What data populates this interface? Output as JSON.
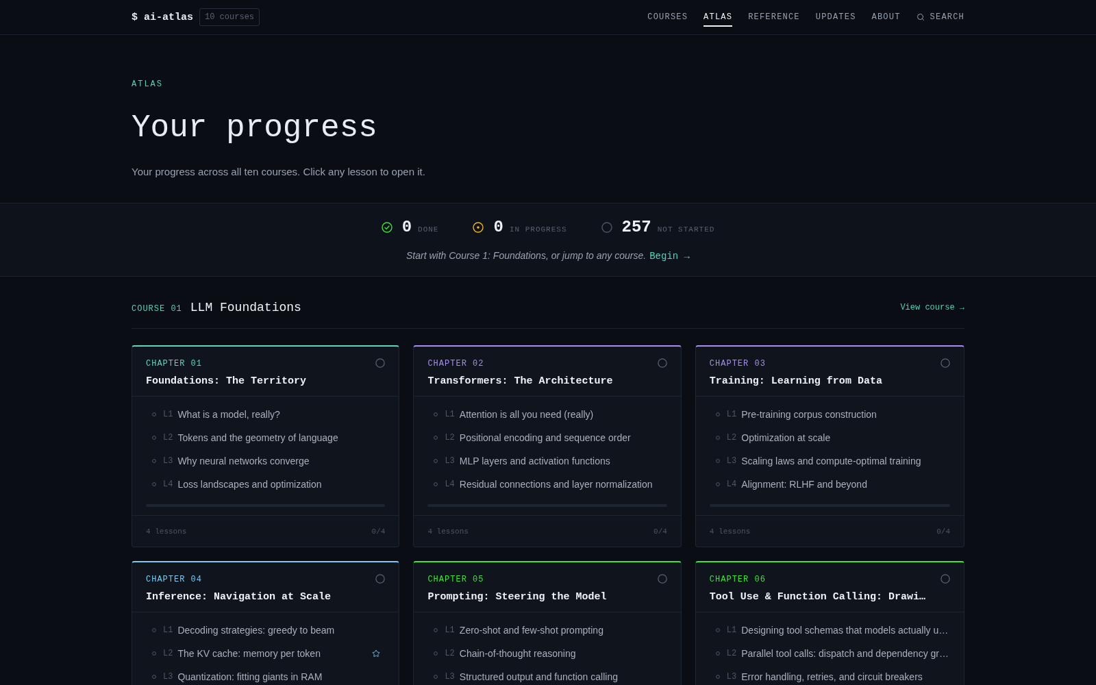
{
  "header": {
    "brand": "$ ai-atlas",
    "badge": "10 courses",
    "nav": [
      {
        "label": "COURSES",
        "selected": false
      },
      {
        "label": "ATLAS",
        "selected": true
      },
      {
        "label": "REFERENCE",
        "selected": false
      },
      {
        "label": "UPDATES",
        "selected": false
      },
      {
        "label": "ABOUT",
        "selected": false
      }
    ],
    "search": "SEARCH"
  },
  "hero": {
    "eyebrow": "ATLAS",
    "title": "Your progress",
    "subtitle": "Your progress across all ten courses. Click any lesson to open it."
  },
  "stats": {
    "items": [
      {
        "kind": "done",
        "count": "0",
        "label": "DONE"
      },
      {
        "kind": "in_progress",
        "count": "0",
        "label": "IN PROGRESS"
      },
      {
        "kind": "not_started",
        "count": "257",
        "label": "NOT STARTED"
      }
    ],
    "hint": "Start with Course 1: Foundations, or jump to any course.",
    "link": "Begin →"
  },
  "course": {
    "label": "COURSE 01",
    "title": "LLM Foundations",
    "link": "View course →",
    "chapters": [
      {
        "label": "CHAPTER 01",
        "title": "Foundations: The Territory",
        "color": "#5cd6bc",
        "done": false,
        "lessons": [
          {
            "code": "L1",
            "title": "What is a model, really?",
            "done": false,
            "starred": false
          },
          {
            "code": "L2",
            "title": "Tokens and the geometry of language",
            "done": false,
            "starred": false
          },
          {
            "code": "L3",
            "title": "Why neural networks converge",
            "done": false,
            "starred": false
          },
          {
            "code": "L4",
            "title": "Loss landscapes and optimization",
            "done": false,
            "starred": false
          }
        ],
        "count": "4 lessons",
        "score": "0/4"
      },
      {
        "label": "CHAPTER 02",
        "title": "Transformers: The Architecture",
        "color": "#a98bf5",
        "done": false,
        "lessons": [
          {
            "code": "L1",
            "title": "Attention is all you need (really)",
            "done": false,
            "starred": false
          },
          {
            "code": "L2",
            "title": "Positional encoding and sequence order",
            "done": false,
            "starred": false
          },
          {
            "code": "L3",
            "title": "MLP layers and activation functions",
            "done": false,
            "starred": false
          },
          {
            "code": "L4",
            "title": "Residual connections and layer normalization",
            "done": false,
            "starred": false
          }
        ],
        "count": "4 lessons",
        "score": "0/4"
      },
      {
        "label": "CHAPTER 03",
        "title": "Training: Learning from Data",
        "color": "#a98bf5",
        "done": false,
        "lessons": [
          {
            "code": "L1",
            "title": "Pre-training corpus construction",
            "done": false,
            "starred": false
          },
          {
            "code": "L2",
            "title": "Optimization at scale",
            "done": false,
            "starred": false
          },
          {
            "code": "L3",
            "title": "Scaling laws and compute-optimal training",
            "done": false,
            "starred": false
          },
          {
            "code": "L4",
            "title": "Alignment: RLHF and beyond",
            "done": false,
            "starred": false
          }
        ],
        "count": "4 lessons",
        "score": "0/4"
      },
      {
        "label": "CHAPTER 04",
        "title": "Inference: Navigation at Scale",
        "color": "#7ccaf2",
        "done": false,
        "lessons": [
          {
            "code": "L1",
            "title": "Decoding strategies: greedy to beam",
            "done": false,
            "starred": false
          },
          {
            "code": "L2",
            "title": "The KV cache: memory per token",
            "done": false,
            "starred": true
          },
          {
            "code": "L3",
            "title": "Quantization: fitting giants in RAM",
            "done": false,
            "starred": false
          }
        ]
      },
      {
        "label": "CHAPTER 05",
        "title": "Prompting: Steering the Model",
        "color": "#3fe33a",
        "done": false,
        "lessons": [
          {
            "code": "L1",
            "title": "Zero-shot and few-shot prompting",
            "done": false,
            "starred": false
          },
          {
            "code": "L2",
            "title": "Chain-of-thought reasoning",
            "done": false,
            "starred": false
          },
          {
            "code": "L3",
            "title": "Structured output and function calling",
            "done": false,
            "starred": false
          }
        ]
      },
      {
        "label": "CHAPTER 06",
        "title": "Tool Use & Function Calling: Drawi…",
        "color": "#3fe33a",
        "done": false,
        "lessons": [
          {
            "code": "L1",
            "title": "Designing tool schemas that models actually u…",
            "done": false,
            "starred": false
          },
          {
            "code": "L2",
            "title": "Parallel tool calls: dispatch and dependency gr…",
            "done": false,
            "starred": false
          },
          {
            "code": "L3",
            "title": "Error handling, retries, and circuit breakers",
            "done": false,
            "starred": false
          }
        ]
      }
    ]
  }
}
